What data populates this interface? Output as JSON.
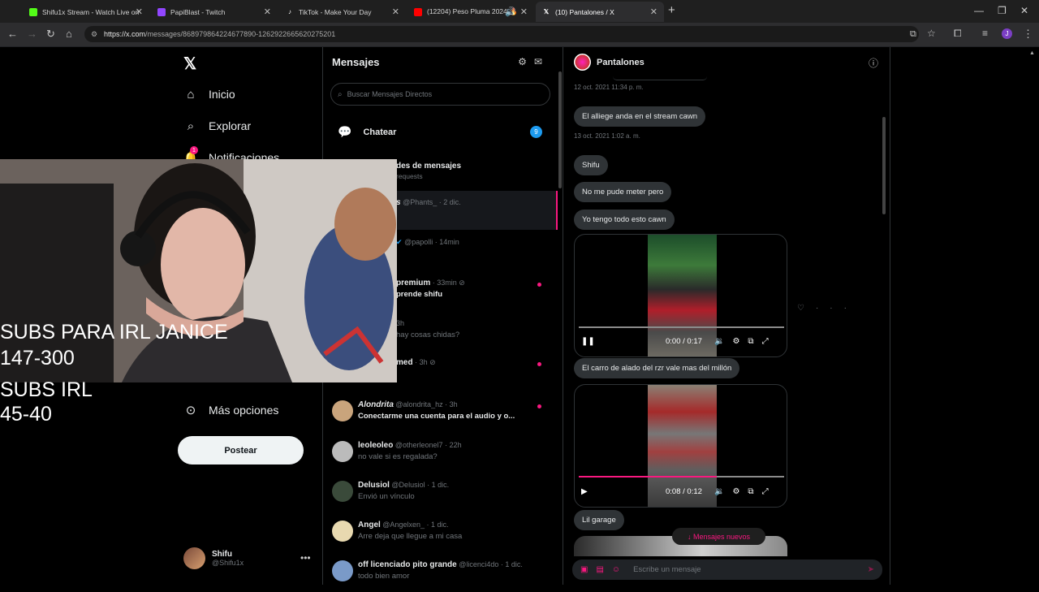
{
  "browser": {
    "tabs": [
      {
        "title": "Shifu1x Stream - Watch Live on",
        "fav_color": "#53fc18"
      },
      {
        "title": "PapiBlast - Twitch",
        "fav_color": "#9146ff"
      },
      {
        "title": "TikTok - Make Your Day",
        "fav_color": "#000000"
      },
      {
        "title": "(12204) Peso Pluma 2024 🔥",
        "fav_color": "#ff0000"
      },
      {
        "title": "(10) Pantalones / X",
        "fav_color": "#000000"
      }
    ],
    "url_host": "https://x.com",
    "url_path": "/messages/868979864224677890-1262922665620275201"
  },
  "sidebar": {
    "items": [
      {
        "label": "Inicio",
        "icon": "home-icon"
      },
      {
        "label": "Explorar",
        "icon": "search-icon"
      },
      {
        "label": "Notificaciones",
        "icon": "bell-icon",
        "badge": "1"
      },
      {
        "label": "Más opciones",
        "icon": "more-circle-icon"
      }
    ],
    "post_label": "Postear",
    "user": {
      "name": "Shifu",
      "handle": "@Shifu1x"
    }
  },
  "dm_list": {
    "title": "Mensajes",
    "search_placeholder": "Buscar Mensajes Directos",
    "chat_label": "Chatear",
    "chat_badge": "9",
    "requests_title": "des de mensajes",
    "requests_sub": "requests",
    "conversations": [
      {
        "name": "s",
        "handle": "@Phants_",
        "time": "2 dic.",
        "preview": "",
        "unread": false
      },
      {
        "name": "",
        "handle": "@papolli",
        "time": "14min",
        "preview": "",
        "unread": false
      },
      {
        "name": "premium",
        "handle": "",
        "time": "33min",
        "preview": "prende shifu",
        "unread": true
      },
      {
        "name": "",
        "handle": "",
        "time": "3h",
        "preview": "hay cosas chidas?",
        "unread": false
      },
      {
        "name": "med",
        "handle": "",
        "time": "3h",
        "preview": "",
        "unread": true
      },
      {
        "name": "Alondrita",
        "handle": "@alondrita_hz",
        "time": "3h",
        "preview": "Conectarme una cuenta para el audio y o...",
        "unread": true
      },
      {
        "name": "leoleoleo",
        "handle": "@otherleonel7",
        "time": "22h",
        "preview": "no vale si es regalada?",
        "unread": false
      },
      {
        "name": "Delusiol",
        "handle": "@Delusiol",
        "time": "1 dic.",
        "preview": "Envió un vínculo",
        "unread": false
      },
      {
        "name": "Angel",
        "handle": "@Angelxen_",
        "time": "1 dic.",
        "preview": "Arre deja que llegue a mi casa",
        "unread": false
      },
      {
        "name": "off licenciado pito grande",
        "handle": "@licenci4do",
        "time": "1 dic.",
        "preview": "todo bien amor",
        "unread": false
      }
    ]
  },
  "chat": {
    "name": "Pantalones",
    "messages": {
      "ts1": "12 oct. 2021 11:34 p. m.",
      "m1": "El alliege anda en el stream cawn",
      "ts2": "13 oct. 2021 1:02 a. m.",
      "m2": "Shifu",
      "m3": "No me pude meter pero",
      "m4": "Yo tengo todo esto cawn",
      "m5": "El carro de alado del rzr vale mas del millón",
      "m6": "Lil garage"
    },
    "video1": {
      "time": "0:00 / 0:17",
      "progress": 0.0
    },
    "video2": {
      "time": "0:08 / 0:12",
      "progress": 0.67
    },
    "new_messages": "↓ Mensajes nuevos",
    "composer_placeholder": "Escribe un mensaje"
  },
  "stream_overlay": {
    "line1": "SUBS PARA IRL JANICE",
    "line2": "147-300",
    "line3": "SUBS IRL",
    "line4": "45-40"
  },
  "colors": {
    "accent": "#f91880",
    "badge_blue": "#1d9bf0"
  }
}
